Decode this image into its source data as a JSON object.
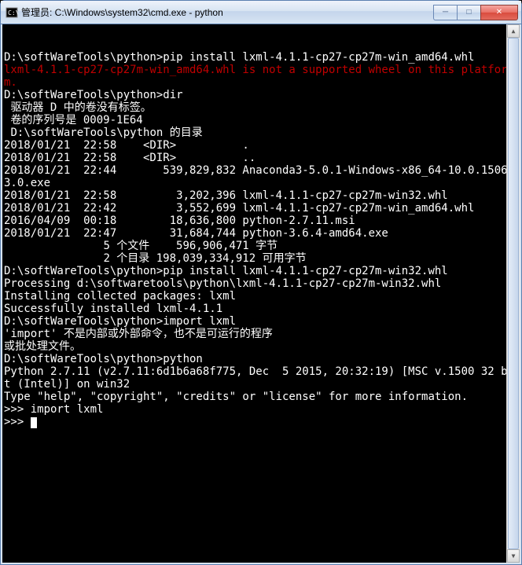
{
  "window": {
    "title": "管理员: C:\\Windows\\system32\\cmd.exe - python"
  },
  "terminal": {
    "lines": [
      {
        "text": ""
      },
      {
        "text": "D:\\softWareTools\\python>pip install lxml-4.1.1-cp27-cp27m-win_amd64.whl"
      },
      {
        "text": "lxml-4.1.1-cp27-cp27m-win_amd64.whl is not a supported wheel on this platform.",
        "class": "red"
      },
      {
        "text": ""
      },
      {
        "text": "D:\\softWareTools\\python>dir"
      },
      {
        "text": " 驱动器 D 中的卷没有标签。"
      },
      {
        "text": " 卷的序列号是 0009-1E64"
      },
      {
        "text": ""
      },
      {
        "text": " D:\\softWareTools\\python 的目录"
      },
      {
        "text": ""
      },
      {
        "text": "2018/01/21  22:58    <DIR>          ."
      },
      {
        "text": "2018/01/21  22:58    <DIR>          .."
      },
      {
        "text": "2018/01/21  22:44       539,829,832 Anaconda3-5.0.1-Windows-x86_64-10.0.15063.0.exe"
      },
      {
        "text": "2018/01/21  22:58         3,202,396 lxml-4.1.1-cp27-cp27m-win32.whl"
      },
      {
        "text": "2018/01/21  22:42         3,552,699 lxml-4.1.1-cp27-cp27m-win_amd64.whl"
      },
      {
        "text": "2016/04/09  00:18        18,636,800 python-2.7.11.msi"
      },
      {
        "text": "2018/01/21  22:47        31,684,744 python-3.6.4-amd64.exe"
      },
      {
        "text": "               5 个文件    596,906,471 字节"
      },
      {
        "text": "               2 个目录 198,039,334,912 可用字节"
      },
      {
        "text": ""
      },
      {
        "text": "D:\\softWareTools\\python>pip install lxml-4.1.1-cp27-cp27m-win32.whl"
      },
      {
        "text": "Processing d:\\softwaretools\\python\\lxml-4.1.1-cp27-cp27m-win32.whl"
      },
      {
        "text": "Installing collected packages: lxml"
      },
      {
        "text": "Successfully installed lxml-4.1.1"
      },
      {
        "text": ""
      },
      {
        "text": "D:\\softWareTools\\python>import lxml"
      },
      {
        "text": "'import' 不是内部或外部命令，也不是可运行的程序"
      },
      {
        "text": "或批处理文件。"
      },
      {
        "text": ""
      },
      {
        "text": "D:\\softWareTools\\python>python"
      },
      {
        "text": "Python 2.7.11 (v2.7.11:6d1b6a68f775, Dec  5 2015, 20:32:19) [MSC v.1500 32 bit (Intel)] on win32"
      },
      {
        "text": "Type \"help\", \"copyright\", \"credits\" or \"license\" for more information."
      },
      {
        "text": ">>> import lxml"
      },
      {
        "text": ">>> ",
        "cursor": true
      }
    ]
  },
  "controls": {
    "min_glyph": "─",
    "max_glyph": "□",
    "close_glyph": "✕",
    "sb_up": "▲",
    "sb_down": "▼"
  }
}
